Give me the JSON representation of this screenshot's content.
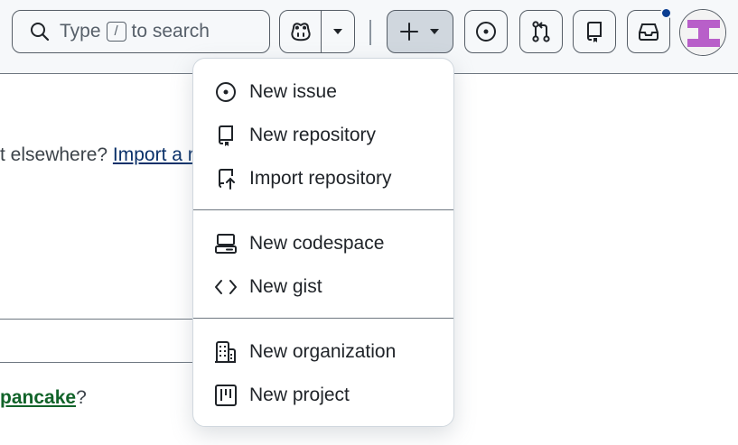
{
  "header": {
    "search": {
      "prefix": "Type",
      "key": "/",
      "suffix": "to search",
      "icon": "search-icon"
    },
    "copilot": {
      "icon": "copilot-icon",
      "dropdown_icon": "triangle-down-icon"
    },
    "create": {
      "icon": "plus-icon",
      "dropdown_icon": "triangle-down-icon"
    },
    "issues": {
      "icon": "issue-opened-icon"
    },
    "pulls": {
      "icon": "git-pull-request-icon"
    },
    "repos": {
      "icon": "repo-icon"
    },
    "inbox": {
      "icon": "inbox-icon",
      "has_unread": true
    },
    "avatar": {
      "colors": [
        "#b85fc9",
        "#f3f3f3"
      ]
    }
  },
  "background": {
    "line1_text": "t elsewhere? ",
    "line1_link": "Import a re",
    "line2_link": "pancake",
    "line2_suffix": "?"
  },
  "menu": {
    "items": [
      {
        "label": "New issue",
        "icon": "issue-opened-icon"
      },
      {
        "label": "New repository",
        "icon": "repo-icon"
      },
      {
        "label": "Import repository",
        "icon": "repo-push-icon"
      },
      {
        "label": "New codespace",
        "icon": "codespaces-icon"
      },
      {
        "label": "New gist",
        "icon": "code-icon"
      },
      {
        "label": "New organization",
        "icon": "organization-icon"
      },
      {
        "label": "New project",
        "icon": "project-icon"
      }
    ]
  },
  "colors": {
    "accent_dot": "#0a3d91",
    "link": "#0a3069",
    "link_green": "#116329"
  }
}
